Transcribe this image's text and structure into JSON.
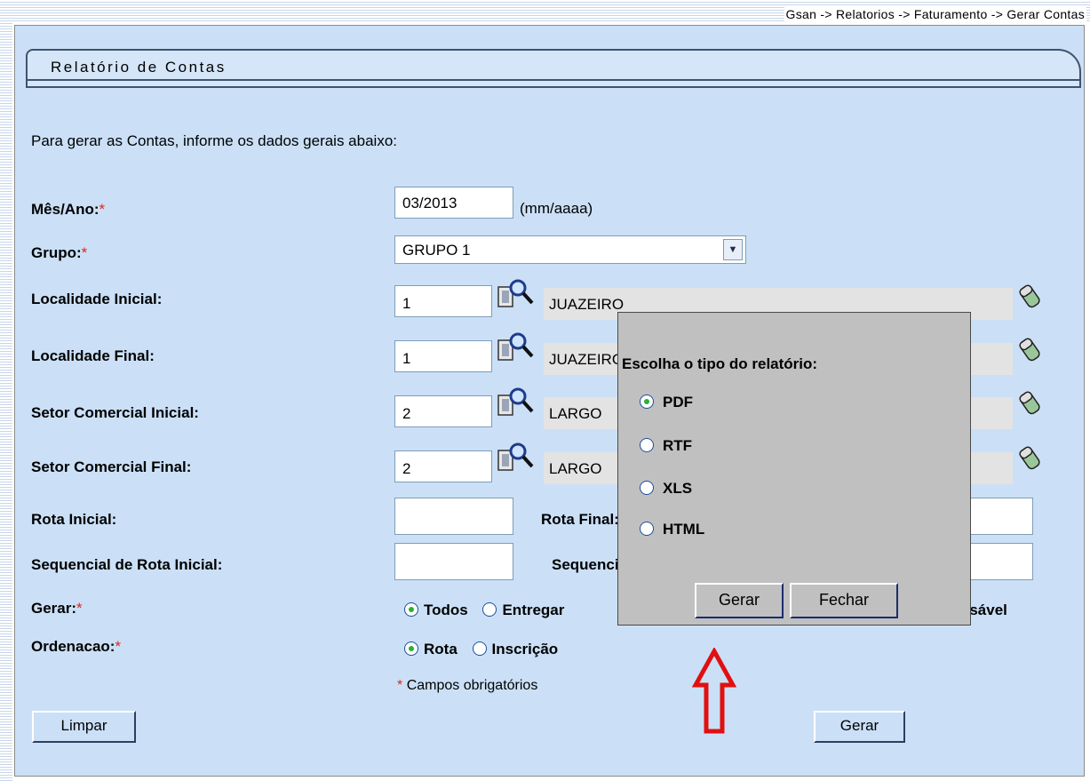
{
  "breadcrumb": "Gsan -> Relatorios -> Faturamento -> Gerar Contas",
  "page_title": "Relatório de Contas",
  "intro_text": "Para gerar as Contas, informe os dados gerais abaixo:",
  "required_mark": "*",
  "fields": {
    "mes_ano": {
      "label": "Mês/Ano:",
      "value": "03/2013",
      "unit": "(mm/aaaa)"
    },
    "grupo": {
      "label": "Grupo:",
      "selected": "GRUPO 1"
    },
    "localidade_inicial": {
      "label": "Localidade Inicial:",
      "value": "1",
      "description": "JUAZEIRO"
    },
    "localidade_final": {
      "label": "Localidade Final:",
      "value": "1",
      "description": "JUAZEIRO"
    },
    "setor_inicial": {
      "label": "Setor Comercial Inicial:",
      "value": "2",
      "description": "LARGO"
    },
    "setor_final": {
      "label": "Setor Comercial Final:",
      "value": "2",
      "description": "LARGO"
    },
    "rota_inicial": {
      "label": "Rota Inicial:",
      "value": ""
    },
    "rota_final": {
      "label": "Rota Final:",
      "value": ""
    },
    "seq_rota_inicial": {
      "label": "Sequencial de Rota Inicial:",
      "value": ""
    },
    "seq_rota_final": {
      "label": "Sequencial de Rota Final:",
      "value": ""
    }
  },
  "gerar": {
    "label": "Gerar:",
    "options": [
      "Todos",
      "Entregar",
      "Responsável"
    ],
    "selected": "Todos"
  },
  "ordenacao": {
    "label": "Ordenacao:",
    "options": [
      "Rota",
      "Inscrição"
    ],
    "selected": "Rota"
  },
  "required_note": "Campos obrigatórios",
  "buttons": {
    "limpar": "Limpar",
    "gerar": "Gerar"
  },
  "popup": {
    "title": "Escolha o tipo do relatório:",
    "options": [
      "PDF",
      "RTF",
      "XLS",
      "HTML"
    ],
    "selected": "PDF",
    "gerar_button": "Gerar",
    "fechar_button": "Fechar"
  },
  "colors": {
    "panel": "#cbe0f7",
    "popup": "#c0c0c0",
    "required": "#e0261b",
    "arrow": "#e01010"
  }
}
